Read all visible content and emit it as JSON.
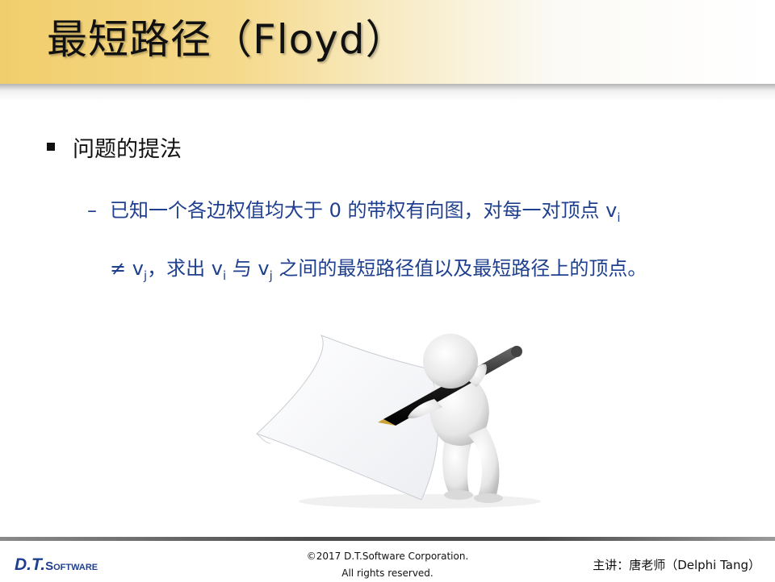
{
  "slide": {
    "title": "最短路径（Floyd）",
    "bullet1": "问题的提法",
    "bullet2": {
      "line1": "已知一个各边权值均大于 0 的带权有向图，对每一对顶点 v",
      "line1_sub": "i",
      "line2_a": "≠ v",
      "line2_sub_a": "j",
      "line2_b": "，求出 v",
      "line2_sub_b": "i",
      "line2_c": " 与 v",
      "line2_sub_c": "j",
      "line2_d": " 之间的最短路径值以及最短路径上的顶点。"
    }
  },
  "footer": {
    "logo_dt": "D.T.",
    "logo_software": "Software",
    "copyright_line1": "©2017 D.T.Software Corporation.",
    "copyright_line2": "All rights reserved.",
    "lecturer": "主讲：唐老师（Delphi Tang）"
  },
  "colors": {
    "title_band": "#f1ce6c",
    "accent_blue": "#1f3f8f"
  }
}
